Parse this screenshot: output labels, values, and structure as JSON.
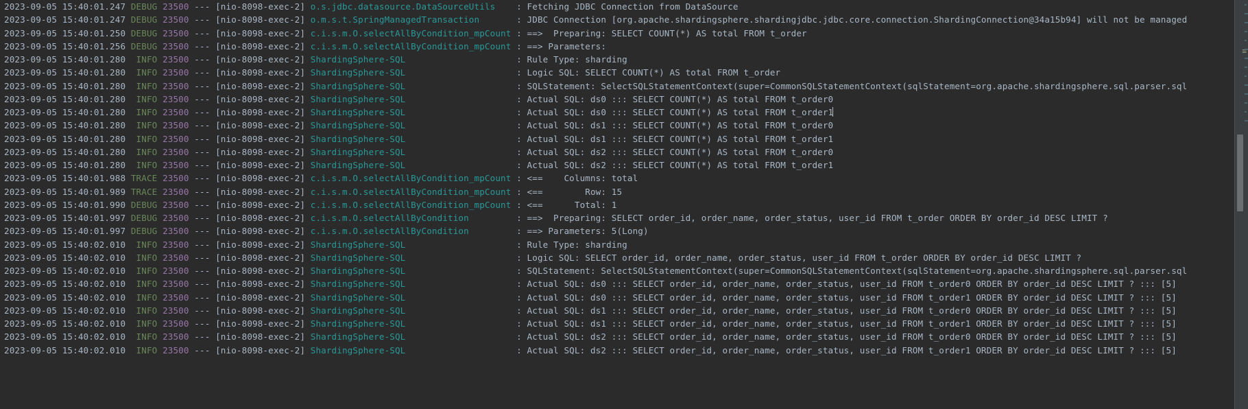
{
  "window": {
    "title": "Console",
    "theme_background": "#2b2b2b",
    "foreground": "#a9b7c6",
    "logger_color": "#299999",
    "level_color": "#6a8759",
    "pid_color": "#9876aa"
  },
  "gutter": {
    "scrollbar_name": "vertical-scrollbar",
    "thumb_name": "scrollbar-thumb",
    "error_marker_glyph": "≡"
  },
  "log": {
    "separator": "---",
    "thread": "[nio-8098-exec-2]",
    "pid": "23500",
    "lines": [
      {
        "timestamp": "2023-09-05 15:40:01.247",
        "level": "DEBUG",
        "logger": "o.s.jdbc.datasource.DataSourceUtils",
        "message": ": Fetching JDBC Connection from DataSource"
      },
      {
        "timestamp": "2023-09-05 15:40:01.247",
        "level": "DEBUG",
        "logger": "o.m.s.t.SpringManagedTransaction",
        "message": ": JDBC Connection [org.apache.shardingsphere.shardingjdbc.jdbc.core.connection.ShardingConnection@34a15b94] will not be managed"
      },
      {
        "timestamp": "2023-09-05 15:40:01.250",
        "level": "DEBUG",
        "logger": "c.i.s.m.O.selectAllByCondition_mpCount",
        "message": ": ==>  Preparing: SELECT COUNT(*) AS total FROM t_order"
      },
      {
        "timestamp": "2023-09-05 15:40:01.256",
        "level": "DEBUG",
        "logger": "c.i.s.m.O.selectAllByCondition_mpCount",
        "message": ": ==> Parameters:"
      },
      {
        "timestamp": "2023-09-05 15:40:01.280",
        "level": "INFO",
        "logger": "ShardingSphere-SQL",
        "message": ": Rule Type: sharding"
      },
      {
        "timestamp": "2023-09-05 15:40:01.280",
        "level": "INFO",
        "logger": "ShardingSphere-SQL",
        "message": ": Logic SQL: SELECT COUNT(*) AS total FROM t_order"
      },
      {
        "timestamp": "2023-09-05 15:40:01.280",
        "level": "INFO",
        "logger": "ShardingSphere-SQL",
        "message": ": SQLStatement: SelectSQLStatementContext(super=CommonSQLStatementContext(sqlStatement=org.apache.shardingsphere.sql.parser.sql"
      },
      {
        "timestamp": "2023-09-05 15:40:01.280",
        "level": "INFO",
        "logger": "ShardingSphere-SQL",
        "message": ": Actual SQL: ds0 ::: SELECT COUNT(*) AS total FROM t_order0"
      },
      {
        "timestamp": "2023-09-05 15:40:01.280",
        "level": "INFO",
        "logger": "ShardingSphere-SQL",
        "message": ": Actual SQL: ds0 ::: SELECT COUNT(*) AS total FROM t_order1",
        "caret_after": true
      },
      {
        "timestamp": "2023-09-05 15:40:01.280",
        "level": "INFO",
        "logger": "ShardingSphere-SQL",
        "message": ": Actual SQL: ds1 ::: SELECT COUNT(*) AS total FROM t_order0"
      },
      {
        "timestamp": "2023-09-05 15:40:01.280",
        "level": "INFO",
        "logger": "ShardingSphere-SQL",
        "message": ": Actual SQL: ds1 ::: SELECT COUNT(*) AS total FROM t_order1"
      },
      {
        "timestamp": "2023-09-05 15:40:01.280",
        "level": "INFO",
        "logger": "ShardingSphere-SQL",
        "message": ": Actual SQL: ds2 ::: SELECT COUNT(*) AS total FROM t_order0"
      },
      {
        "timestamp": "2023-09-05 15:40:01.280",
        "level": "INFO",
        "logger": "ShardingSphere-SQL",
        "message": ": Actual SQL: ds2 ::: SELECT COUNT(*) AS total FROM t_order1"
      },
      {
        "timestamp": "2023-09-05 15:40:01.988",
        "level": "TRACE",
        "logger": "c.i.s.m.O.selectAllByCondition_mpCount",
        "message": ": <==    Columns: total"
      },
      {
        "timestamp": "2023-09-05 15:40:01.989",
        "level": "TRACE",
        "logger": "c.i.s.m.O.selectAllByCondition_mpCount",
        "message": ": <==        Row: 15"
      },
      {
        "timestamp": "2023-09-05 15:40:01.990",
        "level": "DEBUG",
        "logger": "c.i.s.m.O.selectAllByCondition_mpCount",
        "message": ": <==      Total: 1"
      },
      {
        "timestamp": "2023-09-05 15:40:01.997",
        "level": "DEBUG",
        "logger": "c.i.s.m.O.selectAllByCondition",
        "message": ": ==>  Preparing: SELECT order_id, order_name, order_status, user_id FROM t_order ORDER BY order_id DESC LIMIT ?"
      },
      {
        "timestamp": "2023-09-05 15:40:01.997",
        "level": "DEBUG",
        "logger": "c.i.s.m.O.selectAllByCondition",
        "message": ": ==> Parameters: 5(Long)"
      },
      {
        "timestamp": "2023-09-05 15:40:02.010",
        "level": "INFO",
        "logger": "ShardingSphere-SQL",
        "message": ": Rule Type: sharding"
      },
      {
        "timestamp": "2023-09-05 15:40:02.010",
        "level": "INFO",
        "logger": "ShardingSphere-SQL",
        "message": ": Logic SQL: SELECT order_id, order_name, order_status, user_id FROM t_order ORDER BY order_id DESC LIMIT ?"
      },
      {
        "timestamp": "2023-09-05 15:40:02.010",
        "level": "INFO",
        "logger": "ShardingSphere-SQL",
        "message": ": SQLStatement: SelectSQLStatementContext(super=CommonSQLStatementContext(sqlStatement=org.apache.shardingsphere.sql.parser.sql"
      },
      {
        "timestamp": "2023-09-05 15:40:02.010",
        "level": "INFO",
        "logger": "ShardingSphere-SQL",
        "message": ": Actual SQL: ds0 ::: SELECT order_id, order_name, order_status, user_id FROM t_order0 ORDER BY order_id DESC LIMIT ? ::: [5]"
      },
      {
        "timestamp": "2023-09-05 15:40:02.010",
        "level": "INFO",
        "logger": "ShardingSphere-SQL",
        "message": ": Actual SQL: ds0 ::: SELECT order_id, order_name, order_status, user_id FROM t_order1 ORDER BY order_id DESC LIMIT ? ::: [5]"
      },
      {
        "timestamp": "2023-09-05 15:40:02.010",
        "level": "INFO",
        "logger": "ShardingSphere-SQL",
        "message": ": Actual SQL: ds1 ::: SELECT order_id, order_name, order_status, user_id FROM t_order0 ORDER BY order_id DESC LIMIT ? ::: [5]"
      },
      {
        "timestamp": "2023-09-05 15:40:02.010",
        "level": "INFO",
        "logger": "ShardingSphere-SQL",
        "message": ": Actual SQL: ds1 ::: SELECT order_id, order_name, order_status, user_id FROM t_order1 ORDER BY order_id DESC LIMIT ? ::: [5]"
      },
      {
        "timestamp": "2023-09-05 15:40:02.010",
        "level": "INFO",
        "logger": "ShardingSphere-SQL",
        "message": ": Actual SQL: ds2 ::: SELECT order_id, order_name, order_status, user_id FROM t_order0 ORDER BY order_id DESC LIMIT ? ::: [5]"
      },
      {
        "timestamp": "2023-09-05 15:40:02.010",
        "level": "INFO",
        "logger": "ShardingSphere-SQL",
        "message": ": Actual SQL: ds2 ::: SELECT order_id, order_name, order_status, user_id FROM t_order1 ORDER BY order_id DESC LIMIT ? ::: [5]"
      }
    ]
  }
}
